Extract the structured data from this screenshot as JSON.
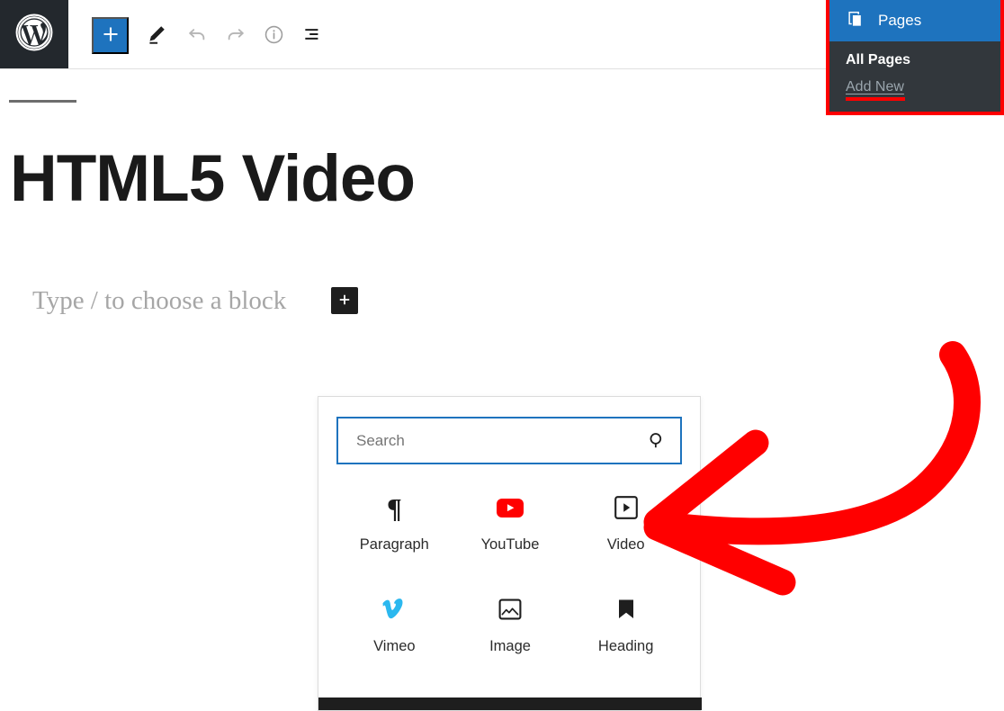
{
  "toolbar": {
    "logo_icon": "wordpress-logo-icon",
    "add_block_label": "+",
    "add_block_icon": "plus-icon",
    "edit_icon": "pencil-icon",
    "undo_icon": "undo-arrow-icon",
    "redo_icon": "redo-arrow-icon",
    "info_icon": "info-circle-icon",
    "list_view_icon": "list-view-icon"
  },
  "canvas": {
    "post_title": "HTML5 Video",
    "block_placeholder": "Type / to choose a block",
    "inline_inserter_label": "+",
    "inline_inserter_icon": "plus-icon"
  },
  "inserter": {
    "search": {
      "value": "",
      "placeholder": "Search",
      "icon": "search-magnifier-icon"
    },
    "blocks": [
      {
        "label": "Paragraph",
        "icon": "paragraph-pilcrow-icon",
        "glyph": "¶"
      },
      {
        "label": "YouTube",
        "icon": "youtube-logo-icon"
      },
      {
        "label": "Video",
        "icon": "video-play-square-icon"
      },
      {
        "label": "Vimeo",
        "icon": "vimeo-logo-icon",
        "glyph": "v"
      },
      {
        "label": "Image",
        "icon": "image-picture-icon"
      },
      {
        "label": "Heading",
        "icon": "heading-bookmark-icon"
      }
    ]
  },
  "pages_menu": {
    "header_label": "Pages",
    "header_icon": "pages-document-icon",
    "items": [
      {
        "label": "All Pages"
      },
      {
        "label": "Add New"
      }
    ]
  },
  "annotation": {
    "arrow_icon": "red-curved-arrow-annotation",
    "color": "#ff0000"
  },
  "colors": {
    "wp_blue": "#1e73be",
    "admin_dark": "#32373c",
    "logo_tile": "#23282d",
    "annotation_red": "#ff0000",
    "youtube_red": "#ff0000",
    "vimeo_cyan": "#2bb8ef",
    "dark_bar": "#1e1e1e"
  }
}
